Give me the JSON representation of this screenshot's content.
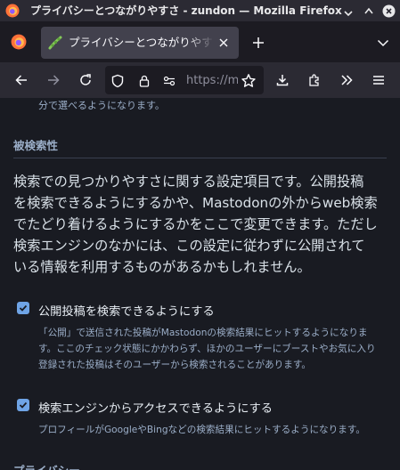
{
  "window": {
    "title": "プライバシーとつながりやすさ - zundon — Mozilla Firefox"
  },
  "tabs": [
    {
      "label": "プライバシーとつながりやすさ",
      "active": true
    }
  ],
  "urlbar": {
    "url": "https://m"
  },
  "page": {
    "top_hint": "分で選べるようになります。",
    "discoverability_title": "被検索性",
    "lead_lines": [
      "検索での見つかりやすさに関する設定項目です。公開投稿",
      "を検索できるようにするかや、Mastodonの外からweb検索",
      "でたどり着けるようにするかをここで変更できます。ただし",
      "検索エンジンのなかには、この設定に従わずに公開されて",
      "いる情報を利用するものがあるかもしれません。"
    ],
    "options": [
      {
        "label": "公開投稿を検索できるようにする",
        "checked": true,
        "hint_lines": [
          "「公開」で送信された投稿がMastodonの検索結果にヒットするようになりま",
          "す。ここのチェック状態にかかわらず、ほかのユーザーにブーストやお気に入り",
          "登録された投稿はそのユーザーから検索されることがあります。"
        ]
      },
      {
        "label": "検索エンジンからアクセスできるようにする",
        "checked": true,
        "hint_lines": [
          "プロフィールがGoogleやBingなどの検索結果にヒットするようになります。"
        ]
      }
    ],
    "privacy_title": "プライバシー"
  },
  "colors": {
    "page_bg": "#191b22",
    "accent": "#6fa4e6",
    "secondary_text": "#9baec8",
    "primary_text": "#d9e1e8",
    "toolbar_bg": "#2b2a33",
    "tab_active_bg": "#42414d"
  }
}
